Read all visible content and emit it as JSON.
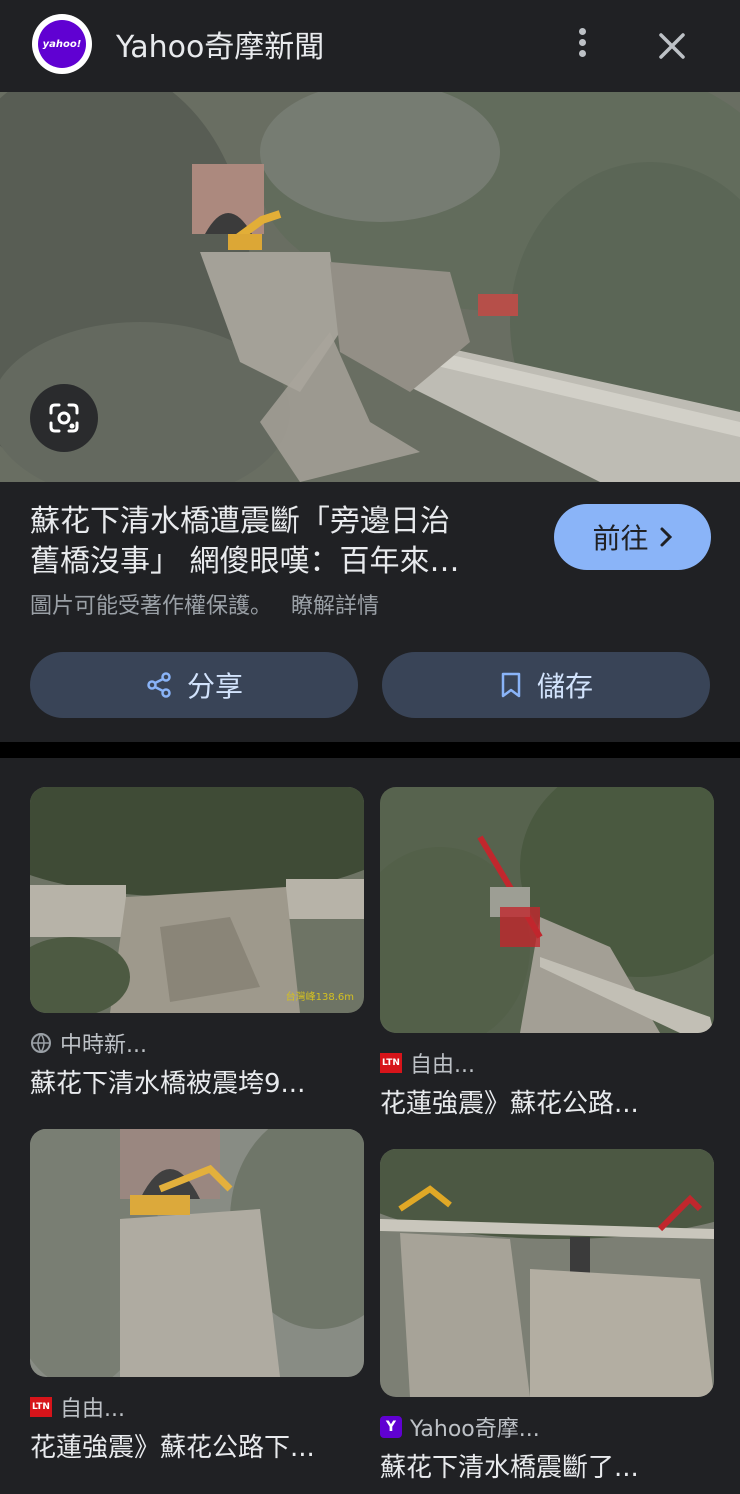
{
  "header": {
    "logo_text": "yahoo!",
    "title": "Yahoo奇摩新聞",
    "icons": [
      "more-vert-icon",
      "close-icon"
    ]
  },
  "article": {
    "title_line1": "蘇花下清水橋遭震斷「旁邊日治",
    "title_line2": "舊橋沒事」 網傻眼嘆：百年來…",
    "visit_label": "前往",
    "copyright_notice": "圖片可能受著作權保護。",
    "learn_more": "瞭解詳情",
    "share_label": "分享",
    "save_label": "儲存"
  },
  "related": [
    {
      "source": "中時新...",
      "source_icon": "globe-icon",
      "caption": "蘇花下清水橋被震垮9...",
      "watermark": "台灣峰138.6m"
    },
    {
      "source": "自由...",
      "source_icon": "ltn-logo",
      "caption": "花蓮強震》蘇花公路..."
    },
    {
      "source": "自由...",
      "source_icon": "ltn-logo",
      "caption": "花蓮強震》蘇花公路下..."
    },
    {
      "source": "Yahoo奇摩...",
      "source_icon": "yahoo-logo",
      "caption": "蘇花下清水橋震斷了..."
    }
  ],
  "colors": {
    "background": "#202124",
    "accent_button": "#8ab4f8",
    "action_button": "#394457",
    "yahoo_purple": "#6001d2",
    "ltn_red": "#d7141a"
  }
}
